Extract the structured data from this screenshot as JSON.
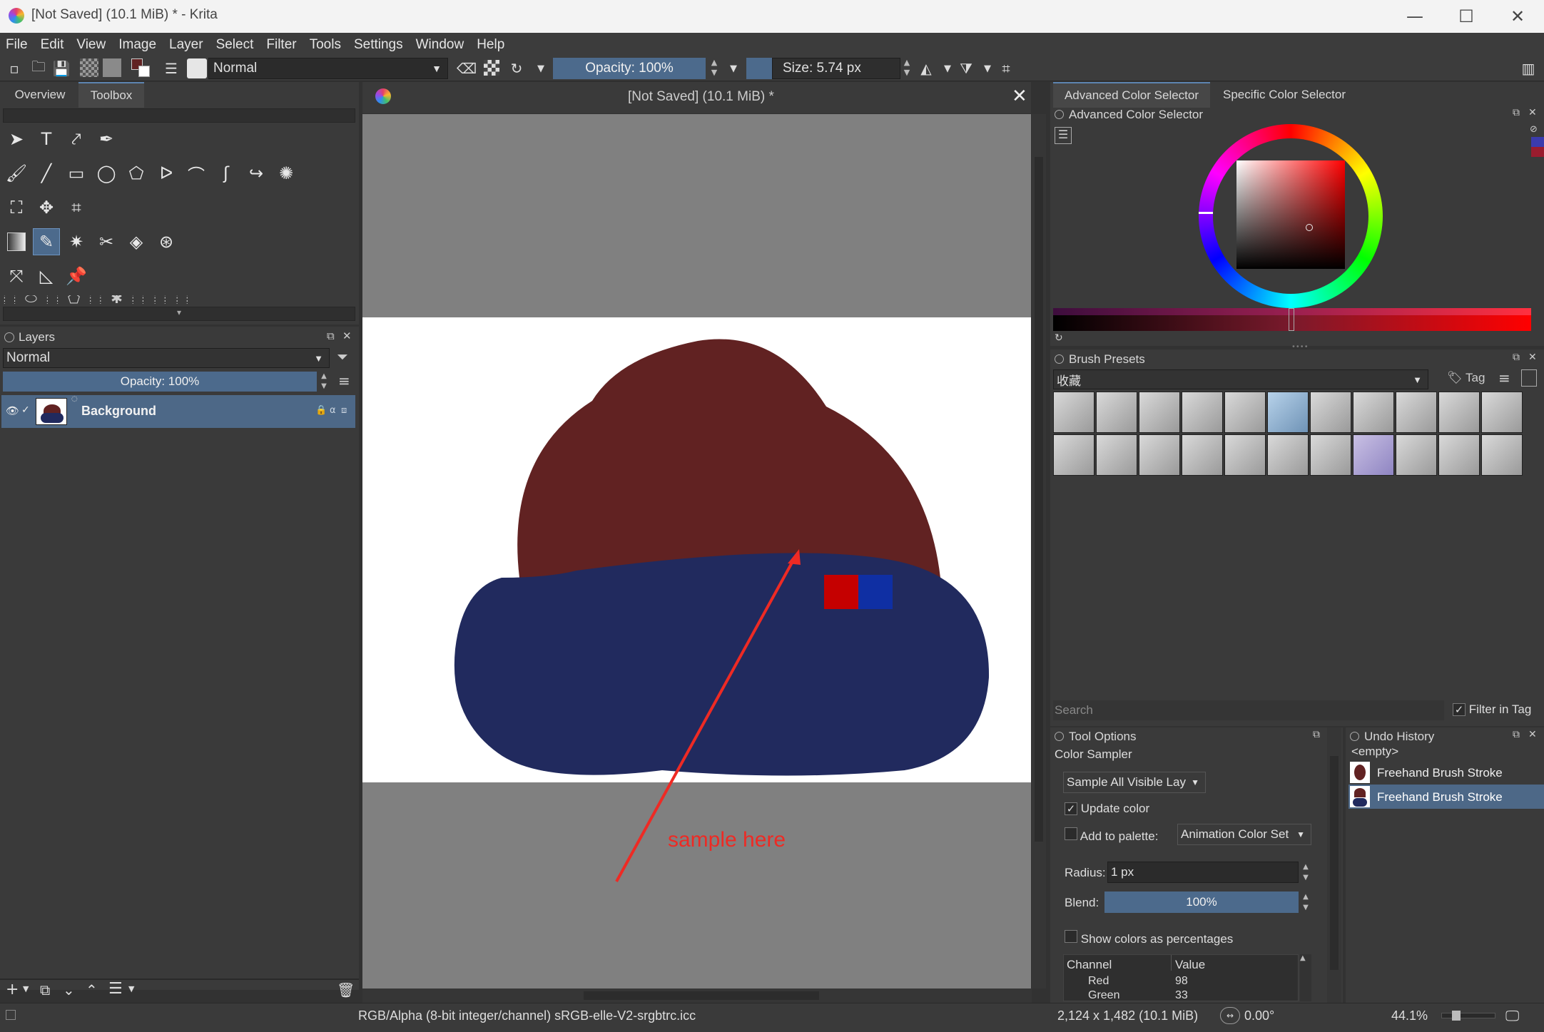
{
  "window": {
    "title": "[Not Saved]  (10.1 MiB) * - Krita",
    "minimize": "—",
    "maximize": "☐",
    "close": "✕"
  },
  "menu": [
    "File",
    "Edit",
    "View",
    "Image",
    "Layer",
    "Select",
    "Filter",
    "Tools",
    "Settings",
    "Window",
    "Help"
  ],
  "toolbar": {
    "blend_mode": "Normal",
    "opacity": "Opacity: 100%",
    "size": "Size: 5.74 px"
  },
  "left_tabs": [
    "Overview",
    "Toolbox"
  ],
  "layers": {
    "title": "Layers",
    "blend_mode": "Normal",
    "opacity": "Opacity:  100%",
    "items": [
      {
        "name": "Background"
      }
    ]
  },
  "document_tab": {
    "title": "[Not Saved]  (10.1 MiB) *"
  },
  "canvas": {
    "annotation": "sample here",
    "colors": {
      "hat": "#612222",
      "body": "#212a5e",
      "swatch_red": "#c50000",
      "swatch_blue": "#0f2fa3",
      "arrow": "#ee2a24"
    }
  },
  "right_tabs": [
    "Advanced Color Selector",
    "Specific Color Selector"
  ],
  "color_selector": {
    "title": "Advanced Color Selector"
  },
  "brush_presets": {
    "title": "Brush Presets",
    "tag": "收藏",
    "tag_button": "Tag",
    "search_placeholder": "Search",
    "filter_in_tag": "Filter in Tag"
  },
  "tool_options": {
    "title": "Tool Options",
    "tool_name": "Color Sampler",
    "sample_mode": "Sample All Visible Lay",
    "update_color": "Update color",
    "add_to_palette": "Add to palette:",
    "palette": "Animation Color Set",
    "radius_label": "Radius:",
    "radius_value": "1 px",
    "blend_label": "Blend:",
    "blend_value": "100%",
    "show_percent": "Show colors as percentages",
    "table_headers": [
      "Channel",
      "Value"
    ],
    "table_rows": [
      [
        "Red",
        "98"
      ],
      [
        "Green",
        "33"
      ]
    ]
  },
  "undo_history": {
    "title": "Undo History",
    "items": [
      "<empty>",
      "Freehand Brush Stroke",
      "Freehand Brush Stroke"
    ]
  },
  "status": {
    "color_space": "RGB/Alpha (8-bit integer/channel)  sRGB-elle-V2-srgbtrc.icc",
    "dimensions": "2,124 x 1,482 (10.1 MiB)",
    "rotation": "0.00°",
    "zoom": "44.1%"
  }
}
